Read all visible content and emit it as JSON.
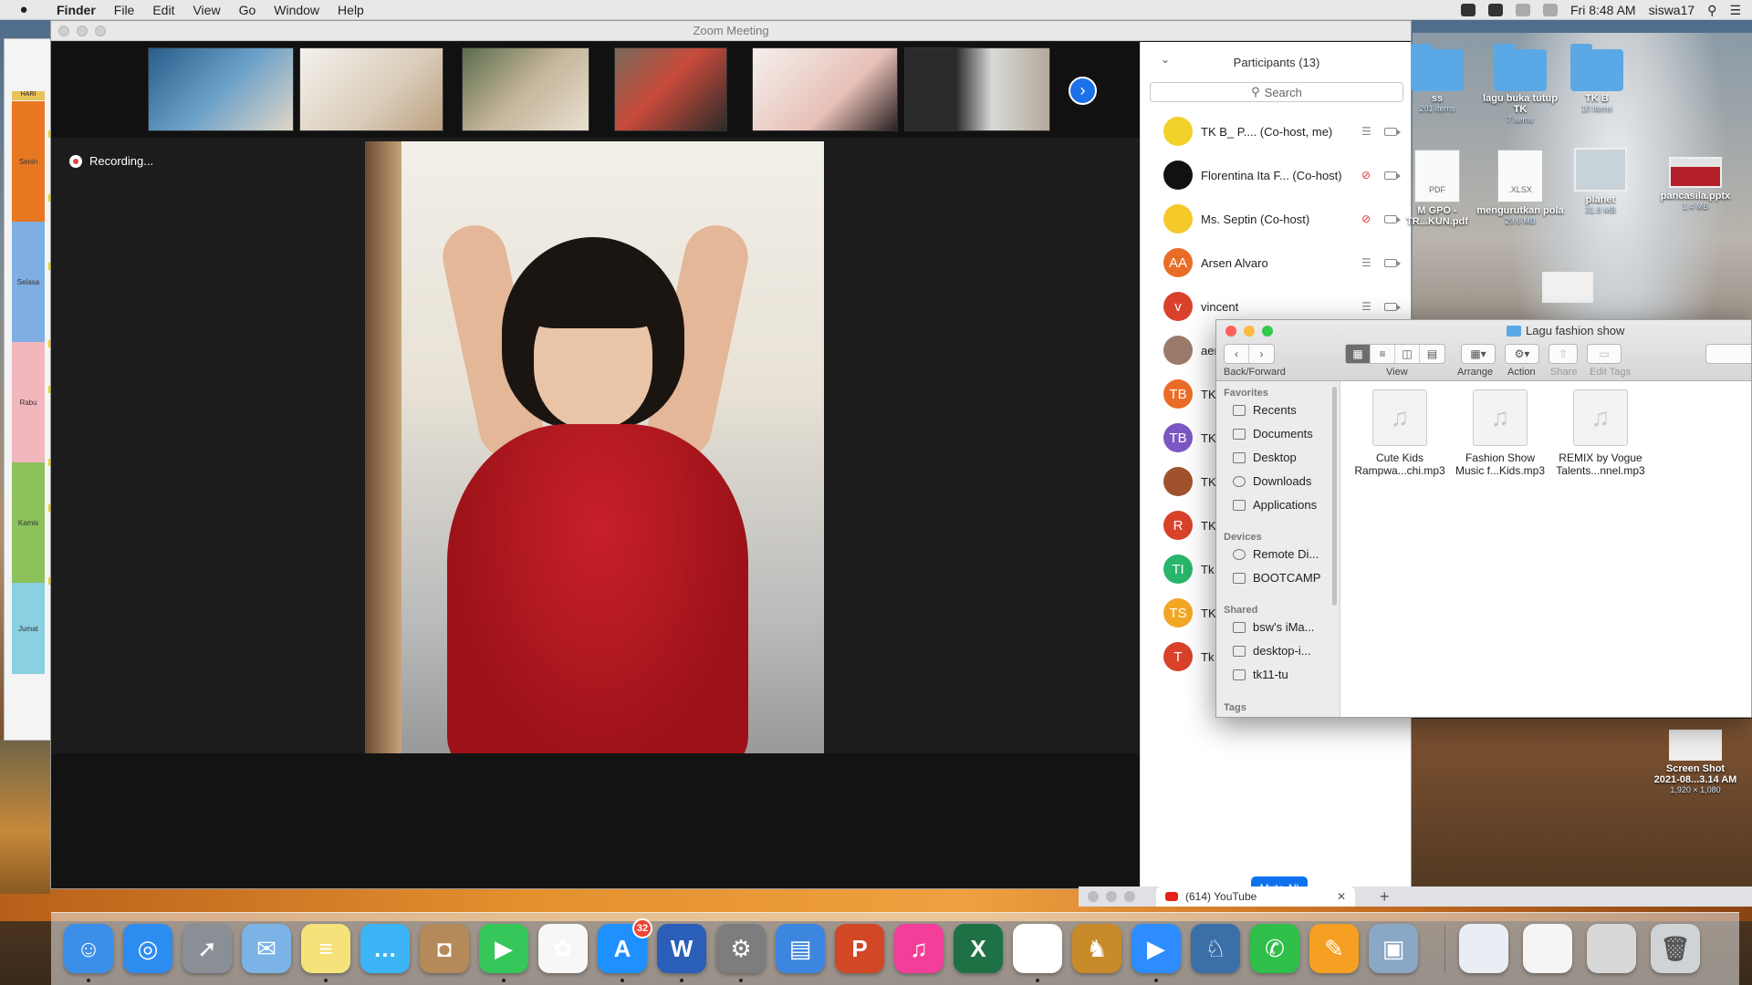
{
  "menubar": {
    "app": "Finder",
    "items": [
      "File",
      "Edit",
      "View",
      "Go",
      "Window",
      "Help"
    ],
    "clock": "Fri 8:48 AM",
    "user": "siswa17"
  },
  "spreadsheet": {
    "header": "HARI",
    "days": [
      "Senin",
      "Selasa",
      "Rabu",
      "Kamis",
      "Jumat"
    ],
    "day_colors": [
      "#e87722",
      "#7faee3",
      "#f2b7bd",
      "#8cc15c",
      "#8ad0e0"
    ]
  },
  "zoom": {
    "title": "Zoom Meeting",
    "recording": "Recording...",
    "participants_title": "Participants (13)",
    "search_placeholder": "Search",
    "mute_all": "Mute All",
    "participants": [
      {
        "initials": "",
        "name": "TK B_ P.... (Co-host, me)",
        "color": "#f2d22a",
        "mic": "on"
      },
      {
        "initials": "",
        "name": "Florentina Ita F...   (Co-host)",
        "color": "#111111",
        "mic": "muted"
      },
      {
        "initials": "",
        "name": "Ms. Septin (Co-host)",
        "color": "#f6c92b",
        "mic": "muted"
      },
      {
        "initials": "AA",
        "name": "Arsen Alvaro",
        "color": "#ea6d27",
        "mic": "on"
      },
      {
        "initials": "v",
        "name": "vincent",
        "color": "#d9412b",
        "mic": "on"
      },
      {
        "initials": "",
        "name": "aer",
        "color": "#9a7a6a",
        "mic": ""
      },
      {
        "initials": "TB",
        "name": "TK",
        "color": "#ea6d27",
        "mic": ""
      },
      {
        "initials": "TB",
        "name": "TK",
        "color": "#7b57c2",
        "mic": ""
      },
      {
        "initials": "",
        "name": "TK",
        "color": "#a0522d",
        "mic": ""
      },
      {
        "initials": "R",
        "name": "TK",
        "color": "#d9412b",
        "mic": ""
      },
      {
        "initials": "TI",
        "name": "Tk",
        "color": "#29b56a",
        "mic": ""
      },
      {
        "initials": "TS",
        "name": "TK",
        "color": "#f2a724",
        "mic": ""
      },
      {
        "initials": "T",
        "name": "Tk",
        "color": "#d9412b",
        "mic": ""
      }
    ]
  },
  "desktop_icons": [
    {
      "name": "ss",
      "sub": "201 items",
      "type": "folder"
    },
    {
      "name": "lagu buka tutup TK",
      "sub": "7 items",
      "type": "folder"
    },
    {
      "name": "TK B",
      "sub": "10 items",
      "type": "folder"
    },
    {
      "name": "M GPO -\nTR...KUN.pdf",
      "sub": "",
      "type": "pdf",
      "badge": "PDF"
    },
    {
      "name": "mengurutkan pola",
      "sub": "29.6 MB",
      "type": "xlsx",
      "badge": ".XLSX"
    },
    {
      "name": "planet",
      "sub": "31.8 MB",
      "type": "thumb"
    },
    {
      "name": "pancasila.pptx",
      "sub": "1.4 MB",
      "type": "thumb"
    },
    {
      "name": "Screen Shot\n2021-08...3.14 AM",
      "sub": "1,920 × 1,080",
      "type": "thumb"
    }
  ],
  "finder": {
    "title": "Lagu fashion show",
    "toolbar_labels": {
      "back_forward": "Back/Forward",
      "view": "View",
      "arrange": "Arrange",
      "action": "Action",
      "share": "Share",
      "edit_tags": "Edit Tags"
    },
    "sections": {
      "favorites": "Favorites",
      "devices": "Devices",
      "shared": "Shared",
      "tags": "Tags"
    },
    "favorites": [
      "Recents",
      "Documents",
      "Desktop",
      "Downloads",
      "Applications"
    ],
    "devices": [
      "Remote Di...",
      "BOOTCAMP"
    ],
    "shared": [
      "bsw's iMa...",
      "desktop-i...",
      "tk11-tu"
    ],
    "files": [
      {
        "line1": "Cute Kids",
        "line2": "Rampwa...chi.mp3"
      },
      {
        "line1": "Fashion Show",
        "line2": "Music f...Kids.mp3"
      },
      {
        "line1": "REMIX by Vogue",
        "line2": "Talents...nnel.mp3"
      }
    ]
  },
  "browser": {
    "tab_title": "(614) YouTube",
    "close": "✕",
    "plus": "+"
  },
  "dock": {
    "appstore_badge": "32",
    "icons": [
      {
        "name": "finder",
        "color": "#3b8fe8",
        "glyph": "☺"
      },
      {
        "name": "safari",
        "color": "#2d8cf0",
        "glyph": "◎"
      },
      {
        "name": "launchpad",
        "color": "#8a8f96",
        "glyph": "➚"
      },
      {
        "name": "mail",
        "color": "#7bb3e6",
        "glyph": "✉"
      },
      {
        "name": "notes",
        "color": "#f5e27a",
        "glyph": "≡"
      },
      {
        "name": "messages",
        "color": "#3cb4f5",
        "glyph": "…"
      },
      {
        "name": "contacts",
        "color": "#b58a5a",
        "glyph": "◘"
      },
      {
        "name": "facetime",
        "color": "#35c759",
        "glyph": "▶"
      },
      {
        "name": "photos",
        "color": "#f7f7f7",
        "glyph": "✿"
      },
      {
        "name": "app-store",
        "color": "#1e90ff",
        "glyph": "A"
      },
      {
        "name": "word",
        "color": "#2b5eb8",
        "glyph": "W"
      },
      {
        "name": "system-preferences",
        "color": "#7d7d7d",
        "glyph": "⚙"
      },
      {
        "name": "keynote",
        "color": "#3d86e0",
        "glyph": "▤"
      },
      {
        "name": "powerpoint",
        "color": "#d24726",
        "glyph": "P"
      },
      {
        "name": "itunes",
        "color": "#f33e9a",
        "glyph": "♫"
      },
      {
        "name": "excel",
        "color": "#1e7145",
        "glyph": "X"
      },
      {
        "name": "chrome",
        "color": "#ffffff",
        "glyph": "◉"
      },
      {
        "name": "lion-app",
        "color": "#c98a2a",
        "glyph": "♞"
      },
      {
        "name": "zoom",
        "color": "#2d8cff",
        "glyph": "▶"
      },
      {
        "name": "giraffe-app",
        "color": "#3a6fa8",
        "glyph": "♘"
      },
      {
        "name": "facetime-alt",
        "color": "#2fbf4a",
        "glyph": "✆"
      },
      {
        "name": "pages",
        "color": "#f6a023",
        "glyph": "✎"
      },
      {
        "name": "preview",
        "color": "#8aa7c5",
        "glyph": "▣"
      }
    ]
  }
}
